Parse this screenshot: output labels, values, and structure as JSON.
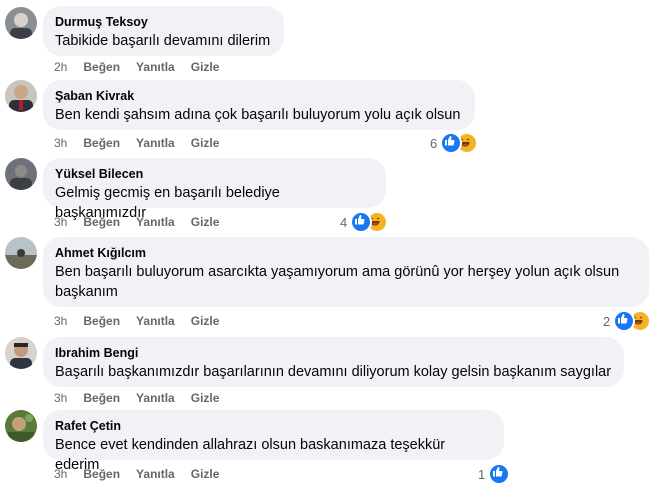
{
  "actions": {
    "like": "Beğen",
    "reply": "Yanıtla",
    "hide": "Gizle"
  },
  "colors": {
    "bubble": "#f0f2f5",
    "like_blue": "#1877f2",
    "haha_yellow": "#f7b125",
    "meta_gray": "#65676b"
  },
  "comments": [
    {
      "author": "Durmuş Teksoy",
      "text": "Tabikide başarılı devamını dilerim",
      "time": "2h",
      "reactions": {
        "count": "",
        "icons": []
      }
    },
    {
      "author": "Şaban Kivrak",
      "text": "Ben kendi şahsım adına çok başarılı buluyorum yolu açık olsun",
      "time": "3h",
      "reactions": {
        "count": "6",
        "icons": [
          "like-icon",
          "haha-icon"
        ]
      }
    },
    {
      "author": "Yüksel Bilecen",
      "text": "Gelmiş gecmiş en başarılı belediye başkanımızdır",
      "time": "3h",
      "reactions": {
        "count": "4",
        "icons": [
          "like-icon",
          "haha-icon"
        ]
      }
    },
    {
      "author": "Ahmet Kığılcım",
      "text_line1": "Ben başarılı buluyorum asarcıkta yaşamıyorum ama görünû yor herşey yolun açık olsun",
      "text_line2": "başkanım",
      "time": "3h",
      "reactions": {
        "count": "2",
        "icons": [
          "like-icon",
          "haha-icon"
        ]
      }
    },
    {
      "author": "Ibrahim Bengi",
      "text": "Başarılı başkanımızdır başarılarının devamını diliyorum kolay gelsin başkanım saygılar",
      "time": "3h",
      "reactions": {
        "count": "",
        "icons": []
      }
    },
    {
      "author": "Rafet Çetin",
      "text": "Bence evet kendinden allahrazı olsun baskanımaza teşekkür ederim",
      "time": "3h",
      "reactions": {
        "count": "1",
        "icons": [
          "like-icon"
        ]
      }
    }
  ]
}
